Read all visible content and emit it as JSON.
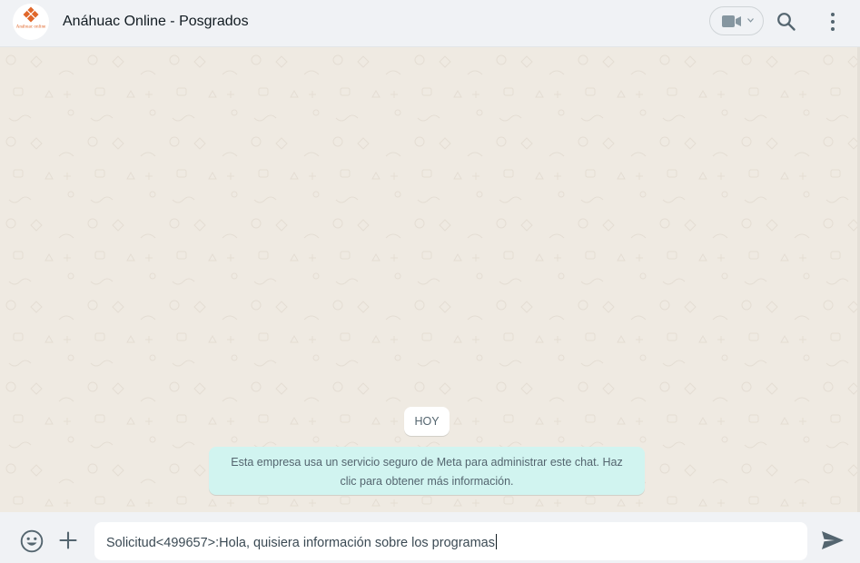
{
  "header": {
    "contact_name": "Anáhuac Online - Posgrados",
    "avatar_logo_text": "Anáhuac online",
    "video_call_icon": "video-camera-icon",
    "search_icon": "search-icon",
    "menu_icon": "more-vertical-icon"
  },
  "chat": {
    "date_divider": "HOY",
    "system_message": "Esta empresa usa un servicio seguro de Meta para administrar este chat. Haz clic para obtener más información."
  },
  "composer": {
    "emoji_icon": "emoji-icon",
    "attach_icon": "plus-icon",
    "message_text": "Solicitud<499657>:Hola, quisiera información sobre los programas",
    "send_icon": "send-icon"
  },
  "colors": {
    "header_bg": "#f0f2f5",
    "chat_bg": "#efeae2",
    "system_bubble": "#d1f4f0",
    "brand_orange": "#e0672b",
    "icon_gray": "#54656f"
  }
}
